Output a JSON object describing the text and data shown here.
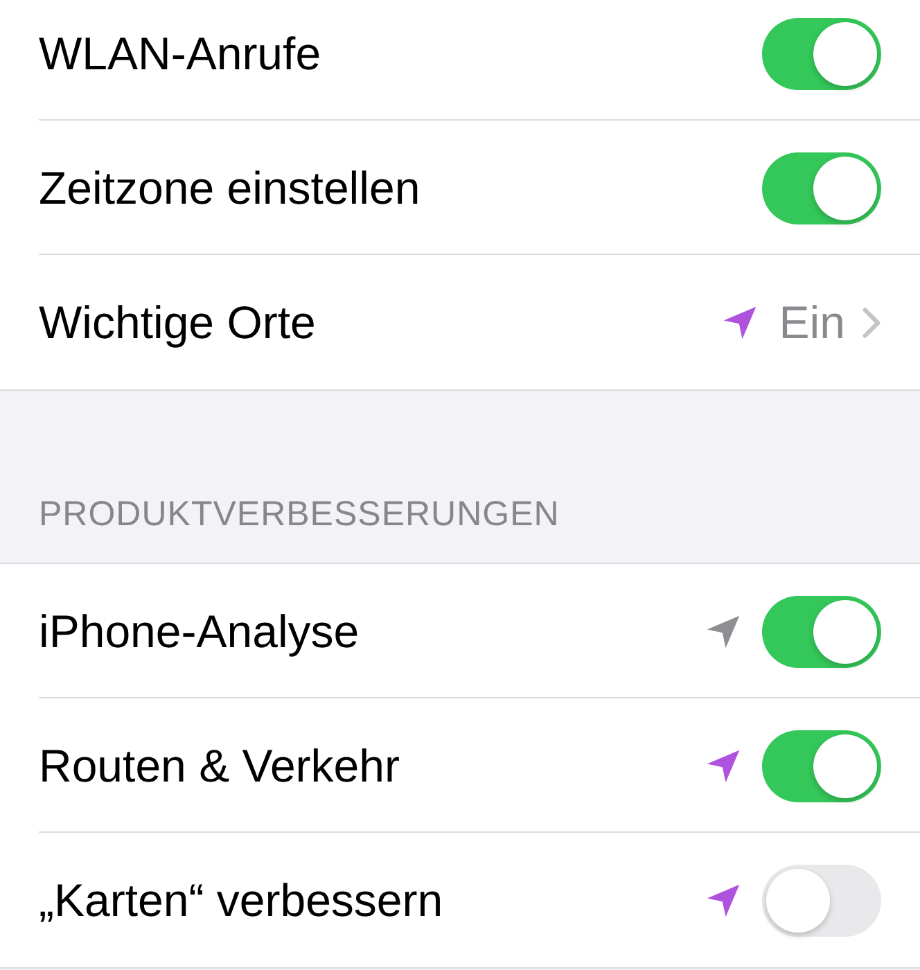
{
  "sections": [
    {
      "rows": [
        {
          "kind": "toggle",
          "label": "WLAN-Anrufe",
          "on": true
        },
        {
          "kind": "toggle",
          "label": "Zeitzone einstellen",
          "on": true
        },
        {
          "kind": "value",
          "label": "Wichtige Orte",
          "value": "Ein",
          "location_arrow": {
            "color": "#af52de"
          }
        }
      ]
    },
    {
      "header": "PRODUKTVERBESSERUNGEN",
      "rows": [
        {
          "kind": "toggle",
          "label": "iPhone-Analyse",
          "on": true,
          "location_arrow": {
            "color": "#8e8e93"
          }
        },
        {
          "kind": "toggle",
          "label": "Routen & Verkehr",
          "on": true,
          "location_arrow": {
            "color": "#af52de"
          }
        },
        {
          "kind": "toggle",
          "label": "„Karten“ verbessern",
          "on": false,
          "location_arrow": {
            "color": "#af52de"
          }
        }
      ]
    }
  ]
}
